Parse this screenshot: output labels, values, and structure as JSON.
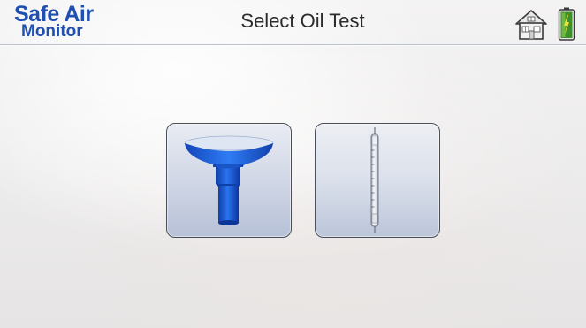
{
  "header": {
    "logo": {
      "line1": "Safe Air",
      "line2": "Monitor"
    },
    "title": "Select Oil Test"
  },
  "status": {
    "home_icon": "home-icon",
    "battery_icon": "battery-icon",
    "battery_color": "#3f8f2a"
  },
  "tests": [
    {
      "icon": "oil-sampler-icon"
    },
    {
      "icon": "detector-tube-icon"
    }
  ],
  "colors": {
    "brand": "#1f4fb0",
    "accent_blue": "#1d5fd6",
    "tile_border": "#4a4f57"
  }
}
